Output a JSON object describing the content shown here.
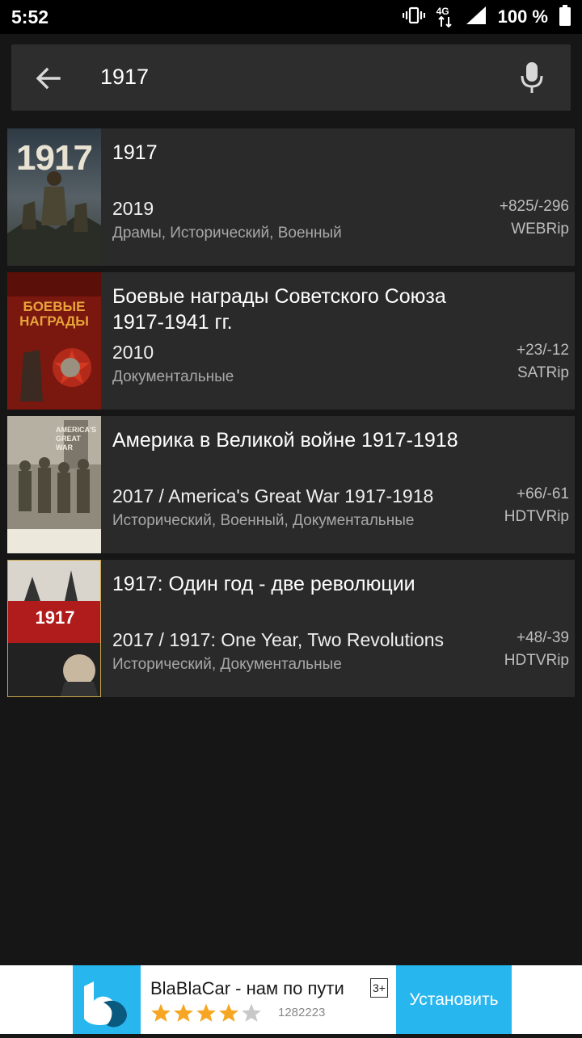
{
  "status_bar": {
    "time": "5:52",
    "network": "4G",
    "battery": "100 %"
  },
  "search": {
    "query": "1917",
    "back_icon": "arrow-left-icon",
    "mic_icon": "microphone-icon"
  },
  "results": [
    {
      "poster_text": "1917",
      "title": "1917",
      "year": "2019",
      "genres": "Драмы, Исторический, Военный",
      "peers": "+825/-296",
      "quality": "WEBRip"
    },
    {
      "poster_text": "БОЕВЫЕ НАГРАДЫ",
      "title": "Боевые награды Советского Союза 1917-1941 гг.",
      "year": "2010",
      "genres": "Документальные",
      "peers": "+23/-12",
      "quality": "SATRip"
    },
    {
      "poster_text": "AMERICA'S GREAT WAR",
      "title": "Америка в Великой войне 1917-1918",
      "year": "2017 / America's Great War 1917-1918",
      "genres": "Исторический, Военный, Документальные",
      "peers": "+66/-61",
      "quality": "HDTVRip"
    },
    {
      "poster_text": "1917",
      "title": "1917: Один год - две революции",
      "year": "2017 / 1917: One Year, Two Revolutions",
      "genres": "Исторический, Документальные",
      "peers": "+48/-39",
      "quality": "HDTVRip"
    }
  ],
  "ad": {
    "app_name": "BlaBlaCar - нам по пути",
    "age_rating": "3+",
    "rating_stars": 4,
    "rating_count": "1282223",
    "install_label": "Установить",
    "brand_color": "#28b6ef"
  }
}
